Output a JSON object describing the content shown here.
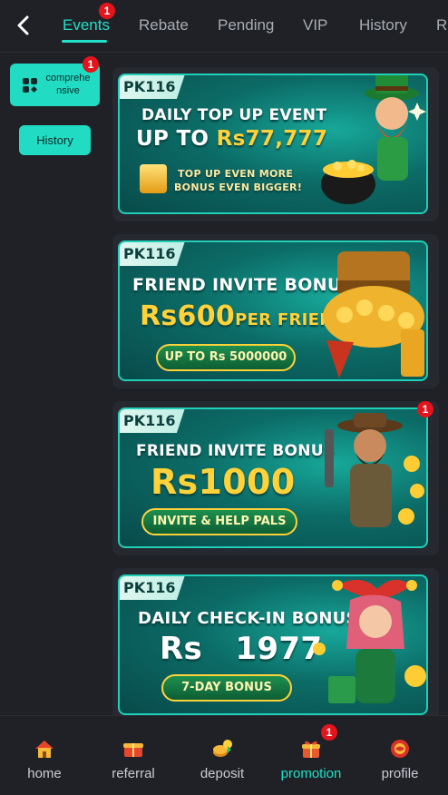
{
  "header": {
    "back_icon": "chevron-left-icon",
    "tabs": [
      {
        "label": "Events",
        "active": true,
        "badge": "1"
      },
      {
        "label": "Rebate",
        "active": false
      },
      {
        "label": "Pending",
        "active": false
      },
      {
        "label": "VIP",
        "active": false
      },
      {
        "label": "History",
        "active": false
      },
      {
        "label": "R",
        "active": false
      }
    ]
  },
  "sidebar": {
    "category": {
      "label": "comprehensive",
      "label_line1": "comprehe",
      "label_line2": "nsive",
      "badge": "1",
      "icon": "grid-icon"
    },
    "history_label": "History"
  },
  "banners": [
    {
      "brand": "PK116",
      "title_line1": "DAILY TOP UP EVENT",
      "title_line2_prefix": "UP TO ",
      "title_line2_amount": "Rs77,777",
      "sub_line1": "TOP UP EVEN MORE",
      "sub_line2": "BONUS EVEN BIGGER!"
    },
    {
      "brand": "PK116",
      "title_line1": "FRIEND INVITE BONUS",
      "amount": "Rs600",
      "amount_suffix": "PER FRIEND",
      "pill": "UP TO Rs 5000000"
    },
    {
      "brand": "PK116",
      "badge": "1",
      "title_line1": "FRIEND INVITE BONUS",
      "amount": "Rs1000",
      "pill": "INVITE & HELP PALS"
    },
    {
      "brand": "PK116",
      "title_line1": "DAILY CHECK-IN BONUS",
      "amount_prefix": "Rs",
      "amount": "1977",
      "pill": "7-DAY BONUS"
    }
  ],
  "bottom_nav": [
    {
      "label": "home",
      "icon": "home-icon",
      "active": false
    },
    {
      "label": "referral",
      "icon": "referral-gift-icon",
      "active": false
    },
    {
      "label": "deposit",
      "icon": "deposit-coins-icon",
      "active": false
    },
    {
      "label": "promotion",
      "icon": "promotion-gift-icon",
      "active": true,
      "badge": "1"
    },
    {
      "label": "profile",
      "icon": "profile-icon",
      "active": false
    }
  ],
  "colors": {
    "accent": "#20e0c8",
    "badge": "#e3141c",
    "background": "#1f2126",
    "gold": "#ffd23a"
  }
}
